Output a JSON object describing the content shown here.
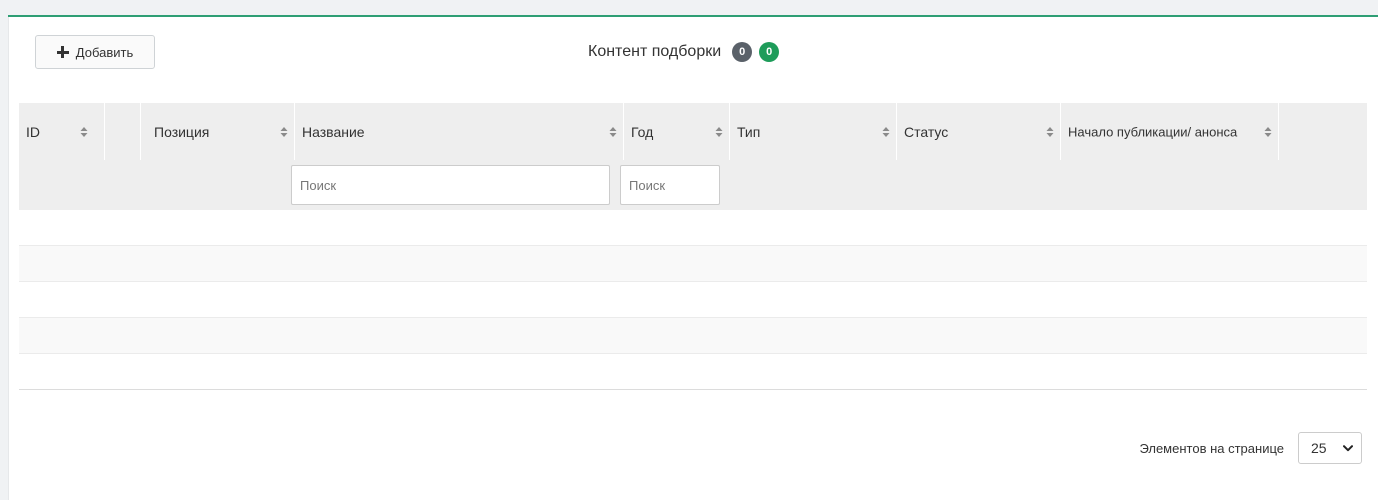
{
  "toolbar": {
    "add_label": "Добавить"
  },
  "title": {
    "text": "Контент подборки",
    "badge_gray": "0",
    "badge_green": "0",
    "badge_gray_color": "#5a6169",
    "badge_green_color": "#1e9c5a"
  },
  "table": {
    "columns": [
      {
        "key": "id",
        "label": "ID",
        "sortable": true
      },
      {
        "key": "blank",
        "label": "",
        "sortable": false
      },
      {
        "key": "position",
        "label": "Позиция",
        "sortable": true
      },
      {
        "key": "name",
        "label": "Название",
        "sortable": true
      },
      {
        "key": "year",
        "label": "Год",
        "sortable": true
      },
      {
        "key": "type",
        "label": "Тип",
        "sortable": true
      },
      {
        "key": "status",
        "label": "Статус",
        "sortable": true
      },
      {
        "key": "publish_start",
        "label": "Начало публикации/ анонса",
        "sortable": true
      }
    ],
    "filters": {
      "name_placeholder": "Поиск",
      "year_placeholder": "Поиск"
    },
    "rows": []
  },
  "pagination": {
    "label": "Элементов на странице",
    "page_size": "25"
  },
  "colors": {
    "accent": "#2e9e74",
    "header_bg": "#eeeeee"
  }
}
